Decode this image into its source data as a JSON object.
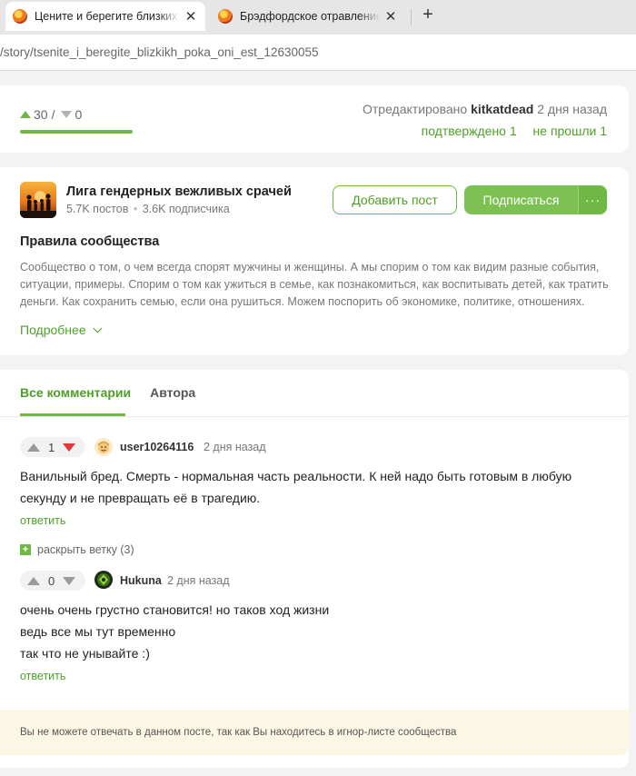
{
  "browser": {
    "tabs": [
      {
        "title": "Цените и берегите близких, пока они есть",
        "active": true
      },
      {
        "title": "Брэдфордское отравление сладостями",
        "active": false
      }
    ],
    "url": "/story/tsenite_i_beregite_blizkikh_poka_oni_est_12630055"
  },
  "post": {
    "upvotes": "30",
    "sep": "/",
    "downvotes": "0",
    "edited_prefix": "Отредактировано",
    "edited_user": "kitkatdead",
    "edited_time": "2 дня назад",
    "confirmed": "подтверждено 1",
    "not_passed": "не прошли 1"
  },
  "community": {
    "name": "Лига гендерных вежливых срачей",
    "posts": "5.7K постов",
    "dot": "•",
    "subscribers": "3.6K подписчика",
    "add_post": "Добавить пост",
    "subscribe": "Подписаться",
    "more": "···",
    "rules_title": "Правила сообщества",
    "rules_text": "Сообщество о том, о чем всегда спорят мужчины и женщины. А мы спорим о том как видим разные события, ситуации, примеры. Спорим о том как ужиться в семье, как познакомиться, как воспитывать детей, как тратить деньги. Как сохранить семью, если она рушиться. Можем поспорить об экономике, политике, отношениях.",
    "more_link": "Подробнее"
  },
  "comments_tabs": {
    "all": "Все комментарии",
    "author": "Автора"
  },
  "comments": [
    {
      "rating": "1",
      "user": "user10264116",
      "time": "2 дня назад",
      "lines": [
        "Ванильный бред. Смерть - нормальная часть реальности. К ней надо быть готовым в любую",
        "секунду и не превращать её в трагедию."
      ],
      "reply": "ответить"
    },
    {
      "rating": "0",
      "user": "Hukuna",
      "time": "2 дня назад",
      "lines": [
        "очень очень грустно становится! но таков ход жизни",
        "ведь все мы тут временно",
        "так что не унывайте :)"
      ],
      "reply": "ответить"
    }
  ],
  "expand_branch": "раскрыть ветку (3)",
  "notice": "Вы не можете отвечать в данном посте, так как Вы находитесь в игнор-листе сообщества",
  "colors": {
    "accent": "#6fb846",
    "accent_text": "#4e9f26",
    "downvote_active": "#e0383e",
    "notice_bg": "#fcf6e5"
  }
}
